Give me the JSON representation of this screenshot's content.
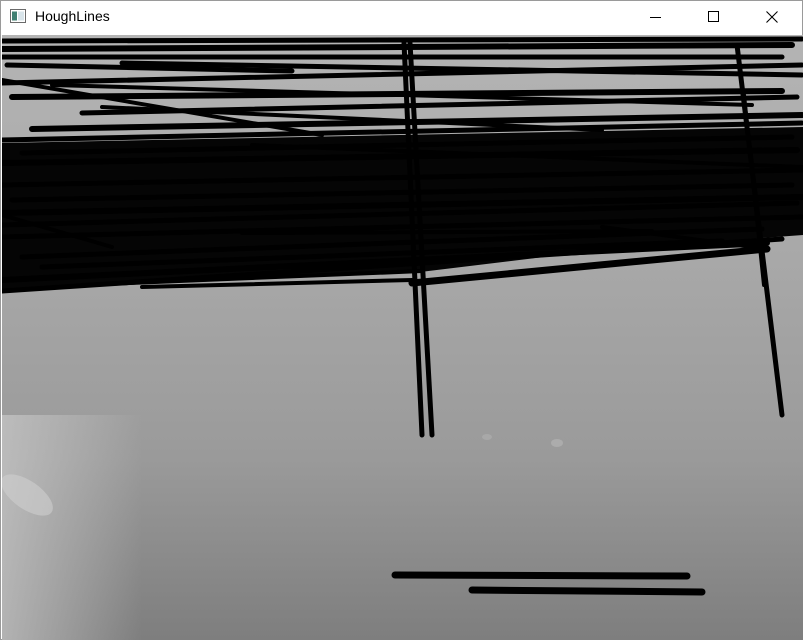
{
  "window": {
    "title": "HoughLines"
  },
  "icons": {
    "app": "app-window-icon",
    "minimize": "minimize-icon",
    "maximize": "maximize-icon",
    "close": "close-icon"
  },
  "image": {
    "description_kind": "grayscale-photo-with-detected-lines",
    "line_color": "#000000",
    "background_top": "#a8a8a8",
    "background_bottom": "#7e7e7e"
  }
}
